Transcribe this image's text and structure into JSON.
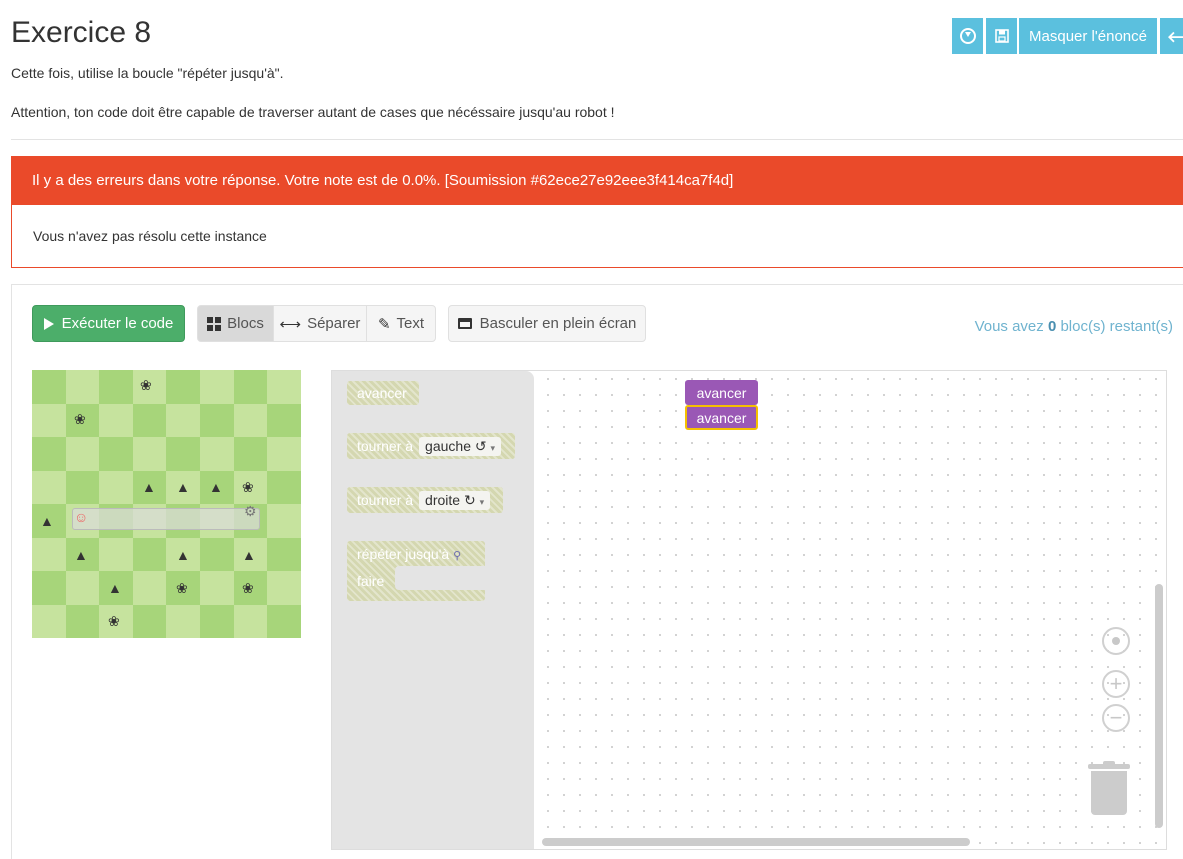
{
  "header": {
    "title": "Exercice 8",
    "hide_statement_label": "Masquer l'énoncé",
    "back_arrow": "🡐"
  },
  "statement": {
    "line1": "Cette fois, utilise la boucle \"répéter jusqu'à\".",
    "line2": "Attention, ton code doit être capable de traverser autant de cases que nécéssaire jusqu'au robot !"
  },
  "alert": {
    "message": "Il y a des erreurs dans votre réponse. Votre note est de 0.0%. [Soumission #62ece27e92eee3f414ca7f4d]",
    "detail": "Vous n'avez pas résolu cette instance"
  },
  "toolbar": {
    "run_label": "Exécuter le code",
    "blocks_label": "Blocs",
    "split_label": "Séparer",
    "text_label": "Text",
    "fullscreen_label": "Basculer en plein écran",
    "remaining_prefix": "Vous avez ",
    "remaining_count": "0",
    "remaining_suffix": " bloc(s) restant(s)"
  },
  "toolbox": {
    "avancer": "avancer",
    "turn": "tourner à",
    "left_option": "gauche ↺",
    "right_option": "droite ↻",
    "repeat": "répéter jusqu'à",
    "do": "faire"
  },
  "workspace": {
    "blocks": [
      "avancer",
      "avancer"
    ]
  },
  "colors": {
    "accent": "#5bc0de",
    "error": "#ea4a2a",
    "run": "#4cae6a",
    "block": "#9a58b5"
  }
}
